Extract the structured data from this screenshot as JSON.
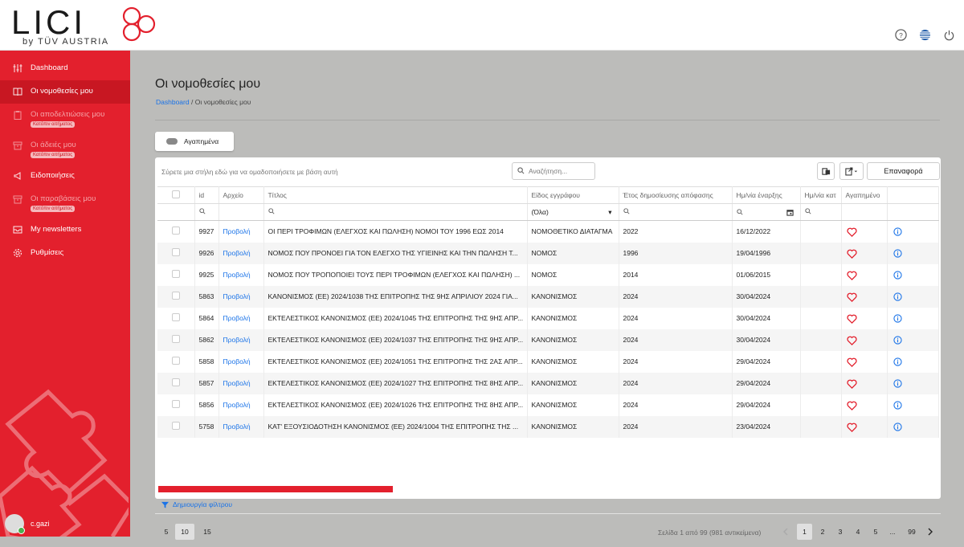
{
  "brand": {
    "logo": "LICI",
    "sub": "by TÜV AUSTRIA"
  },
  "sidebar": {
    "items": [
      {
        "label": "Dashboard",
        "icon": "sliders-icon",
        "active": false,
        "dim": false,
        "badge": ""
      },
      {
        "label": "Οι νομοθεσίες μου",
        "icon": "book-icon",
        "active": true,
        "dim": false,
        "badge": ""
      },
      {
        "label": "Οι αποδελτιώσεις μου",
        "icon": "clipboard-icon",
        "active": false,
        "dim": true,
        "badge": "Κατόπιν αιτήματος"
      },
      {
        "label": "Οι άδειές μου",
        "icon": "box-icon",
        "active": false,
        "dim": true,
        "badge": "Κατόπιν αιτήματος"
      },
      {
        "label": "Ειδοποιήσεις",
        "icon": "megaphone-icon",
        "active": false,
        "dim": false,
        "badge": ""
      },
      {
        "label": "Οι παραβάσεις μου",
        "icon": "box-icon",
        "active": false,
        "dim": true,
        "badge": "Κατόπιν αιτήματος"
      },
      {
        "label": "My newsletters",
        "icon": "inbox-icon",
        "active": false,
        "dim": false,
        "badge": ""
      },
      {
        "label": "Ρυθμίσεις",
        "icon": "gear-icon",
        "active": false,
        "dim": false,
        "badge": ""
      }
    ],
    "user": "c.gazi"
  },
  "page": {
    "title": "Οι νομοθεσίες μου",
    "breadcrumb_home": "Dashboard",
    "breadcrumb_current": "Οι νομοθεσίες μου",
    "favorites_label": "Αγαπημένα"
  },
  "grid": {
    "group_hint": "Σύρετε μια στήλη εδώ για να ομαδοποιήσετε με βάση αυτή",
    "search_placeholder": "Αναζήτηση...",
    "reset_label": "Επαναφορά",
    "columns": [
      "id",
      "Αρχείο",
      "Τίτλος",
      "Είδος εγγράφου",
      "Έτος δημοσίευσης απόφασης",
      "Ημ/νία έναρξης",
      "Ημ/νία κατ",
      "Αγαπημένο"
    ],
    "type_filter": "(Όλα)",
    "rows": [
      {
        "id": "9927",
        "file": "Προβολή",
        "title": "ΟΙ ΠΕΡΙ ΤΡΟΦΙΜΩΝ (ΕΛΕΓΧΟΣ ΚΑΙ ΠΩΛΗΣΗ) ΝΟΜΟΙ ΤΟΥ 1996 ΕΩΣ 2014",
        "type": "ΝΟΜΟΘΕΤΙΚΟ ΔΙΑΤΑΓΜΑ",
        "year": "2022",
        "start": "16/12/2022"
      },
      {
        "id": "9926",
        "file": "Προβολή",
        "title": "ΝΟΜΟΣ ΠΟΥ ΠΡΟΝΟΕΙ ΓΙΑ ΤΟΝ ΕΛΕΓΧΟ ΤΗΣ ΥΓΙΕΙΝΗΣ ΚΑΙ ΤΗΝ ΠΩΛΗΣΗ Τ...",
        "type": "ΝΟΜΟΣ",
        "year": "1996",
        "start": "19/04/1996"
      },
      {
        "id": "9925",
        "file": "Προβολή",
        "title": "ΝΟΜΟΣ ΠΟΥ ΤΡΟΠΟΠΟΙΕΙ ΤΟΥΣ ΠΕΡΙ ΤΡΟΦΙΜΩΝ (ΕΛΕΓΧΟΣ ΚΑΙ ΠΩΛΗΣΗ) ...",
        "type": "ΝΟΜΟΣ",
        "year": "2014",
        "start": "01/06/2015"
      },
      {
        "id": "5863",
        "file": "Προβολή",
        "title": "ΚΑΝΟΝΙΣΜΟΣ (ΕΕ) 2024/1038 ΤΗΣ ΕΠΙΤΡΟΠΗΣ ΤΗΣ 9ΗΣ ΑΠΡΙΛΙΟΥ 2024 ΓΙΑ...",
        "type": "ΚΑΝΟΝΙΣΜΟΣ",
        "year": "2024",
        "start": "30/04/2024"
      },
      {
        "id": "5864",
        "file": "Προβολή",
        "title": "ΕΚΤΕΛΕΣΤΙΚΟΣ ΚΑΝΟΝΙΣΜΟΣ (ΕΕ) 2024/1045 ΤΗΣ ΕΠΙΤΡΟΠΗΣ ΤΗΣ 9ΗΣ ΑΠΡ...",
        "type": "ΚΑΝΟΝΙΣΜΟΣ",
        "year": "2024",
        "start": "30/04/2024"
      },
      {
        "id": "5862",
        "file": "Προβολή",
        "title": "ΕΚΤΕΛΕΣΤΙΚΟΣ ΚΑΝΟΝΙΣΜΟΣ (ΕΕ) 2024/1037 ΤΗΣ ΕΠΙΤΡΟΠΗΣ ΤΗΣ 9ΗΣ ΑΠΡ...",
        "type": "ΚΑΝΟΝΙΣΜΟΣ",
        "year": "2024",
        "start": "30/04/2024"
      },
      {
        "id": "5858",
        "file": "Προβολή",
        "title": "ΕΚΤΕΛΕΣΤΙΚΟΣ ΚΑΝΟΝΙΣΜΟΣ (ΕΕ) 2024/1051 ΤΗΣ ΕΠΙΤΡΟΠΗΣ ΤΗΣ 2ΑΣ ΑΠΡ...",
        "type": "ΚΑΝΟΝΙΣΜΟΣ",
        "year": "2024",
        "start": "29/04/2024"
      },
      {
        "id": "5857",
        "file": "Προβολή",
        "title": "ΕΚΤΕΛΕΣΤΙΚΟΣ ΚΑΝΟΝΙΣΜΟΣ (ΕΕ) 2024/1027 ΤΗΣ ΕΠΙΤΡΟΠΗΣ ΤΗΣ 8ΗΣ ΑΠΡ...",
        "type": "ΚΑΝΟΝΙΣΜΟΣ",
        "year": "2024",
        "start": "29/04/2024"
      },
      {
        "id": "5856",
        "file": "Προβολή",
        "title": "ΕΚΤΕΛΕΣΤΙΚΟΣ ΚΑΝΟΝΙΣΜΟΣ (ΕΕ) 2024/1026 ΤΗΣ ΕΠΙΤΡΟΠΗΣ ΤΗΣ 8ΗΣ ΑΠΡ...",
        "type": "ΚΑΝΟΝΙΣΜΟΣ",
        "year": "2024",
        "start": "29/04/2024"
      },
      {
        "id": "5758",
        "file": "Προβολή",
        "title": "ΚΑΤ' ΕΞΟΥΣΙΟΔΟΤΗΣΗ ΚΑΝΟΝΙΣΜΟΣ (ΕΕ) 2024/1004 ΤΗΣ ΕΠΙΤΡΟΠΗΣ ΤΗΣ ...",
        "type": "ΚΑΝΟΝΙΣΜΟΣ",
        "year": "2024",
        "start": "23/04/2024"
      }
    ],
    "create_filter": "Δημιουργία φίλτρου"
  },
  "pager": {
    "sizes": [
      "5",
      "10",
      "15"
    ],
    "selected_size": "10",
    "info": "Σελίδα 1 από 99 (981 αντικείμενα)",
    "pages": [
      "1",
      "2",
      "3",
      "4",
      "5",
      "...",
      "99"
    ],
    "current": "1"
  },
  "colors": {
    "accent": "#e3202d",
    "link": "#1a73e8"
  }
}
